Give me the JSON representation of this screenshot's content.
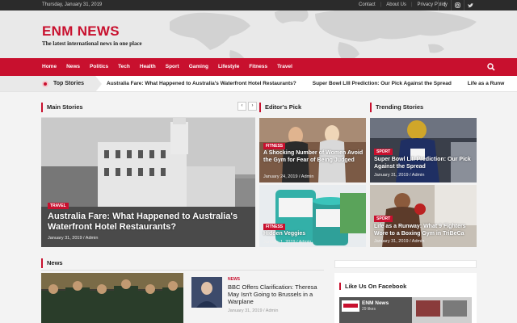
{
  "topbar": {
    "date": "Thursday, January 31, 2019",
    "links": [
      "Contact",
      "About Us",
      "Privacy Policy"
    ],
    "social": [
      "facebook-icon",
      "instagram-icon",
      "twitter-icon"
    ]
  },
  "header": {
    "logo": "ENM NEWS",
    "tagline": "The latest international news in one place"
  },
  "nav": {
    "items": [
      "Home",
      "News",
      "Politics",
      "Tech",
      "Health",
      "Sport",
      "Gaming",
      "Lifestyle",
      "Fitness",
      "Travel"
    ]
  },
  "ticker": {
    "label": "Top Stories",
    "items": [
      "Australia Fare: What Happened to Australia's Waterfront Hotel Restaurants?",
      "Super Bowl LIII Prediction: Our Pick Against the Spread",
      "Life as a Runw"
    ]
  },
  "sections": {
    "main": "Main Stories",
    "editors": "Editor's Pick",
    "trending": "Trending Stories",
    "news": "News",
    "facebook": "Like Us On Facebook"
  },
  "main_story": {
    "category": "TRAVEL",
    "title": "Australia Fare: What Happened to Australia's Waterfront Hotel Restaurants?",
    "meta": "January 31, 2019 / Admin"
  },
  "editors": [
    {
      "category": "FITNESS",
      "title": "A Shocking Number of Women Avoid the Gym for Fear of Being Judged",
      "meta": "January 24, 2019 / Admin"
    },
    {
      "category": "FITNESS",
      "title": "Hidden Veggies",
      "meta": "January 1, 2019 / Admin"
    }
  ],
  "trending": [
    {
      "category": "SPORT",
      "title": "Super Bowl LIII Prediction: Our Pick Against the Spread",
      "meta": "January 31, 2019 / Admin"
    },
    {
      "category": "SPORT",
      "title": "Life as a Runway: What 9 Fighters Wore to a Boxing Gym in TriBeCa",
      "meta": "January 31, 2019 / Admin"
    }
  ],
  "news_item": {
    "category": "NEWS",
    "title": "BBC Offers Clarification: Theresa May Isn't Going to Brussels in a Warplane",
    "meta": "January 31, 2019 / Admin"
  },
  "facebook_card": {
    "name": "ENM News",
    "likes": "29 likes"
  },
  "colors": {
    "accent": "#c8102e",
    "topbar": "#2b2b2b"
  }
}
